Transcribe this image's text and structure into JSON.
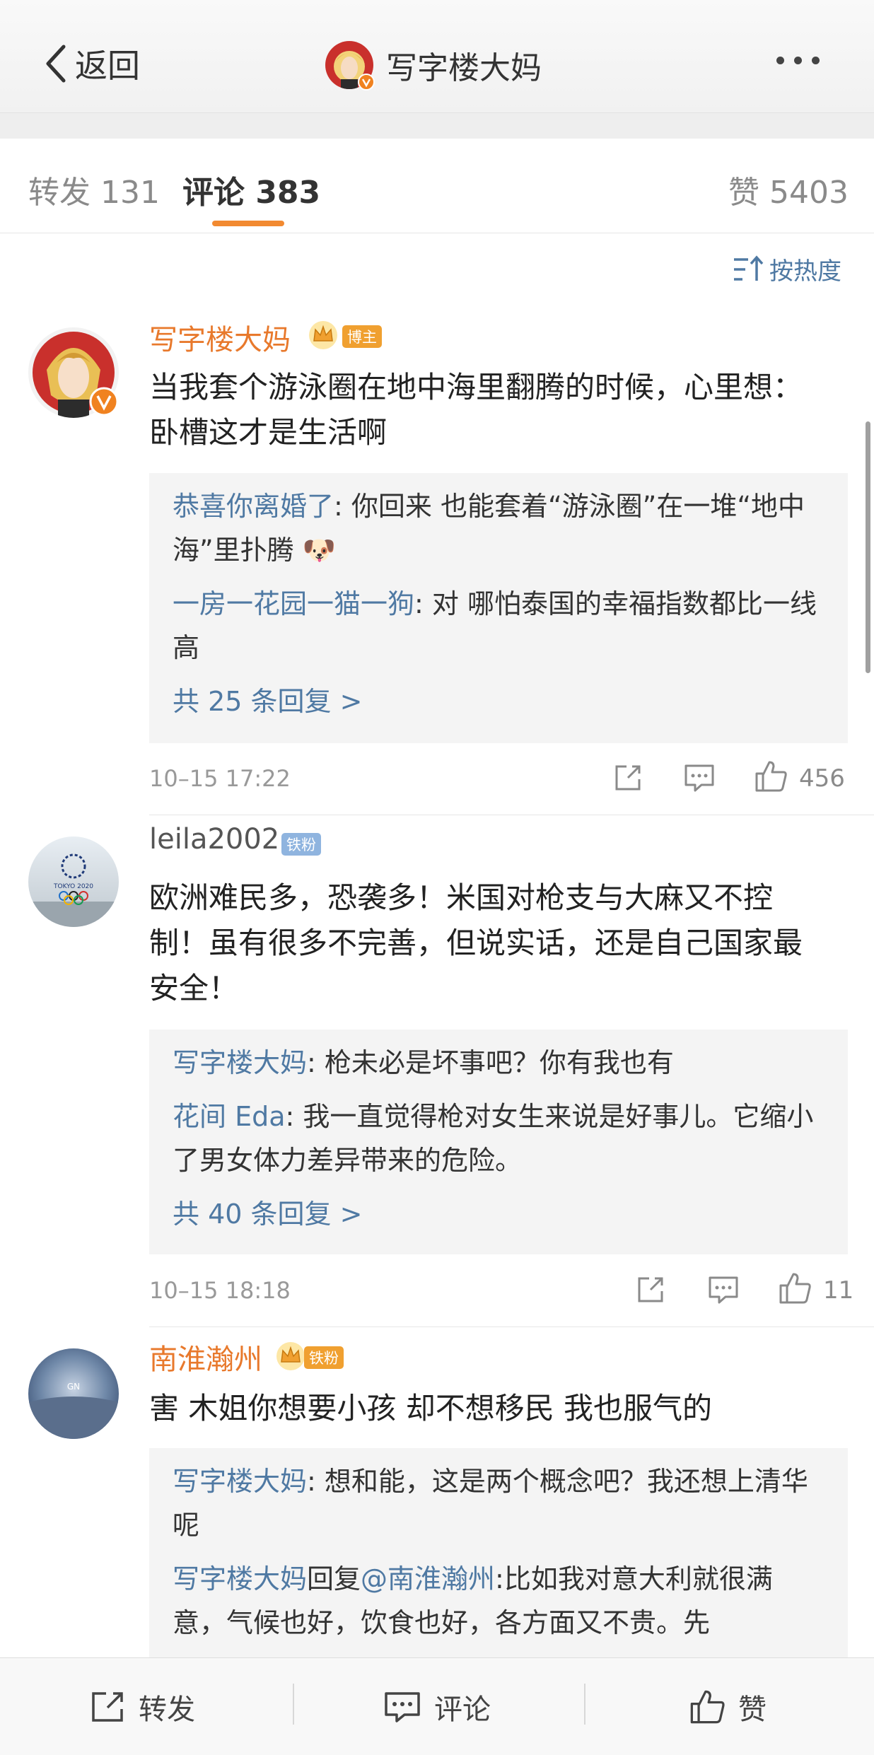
{
  "header": {
    "back_label": "返回",
    "title": "写字楼大妈"
  },
  "tabs": {
    "repost": "转发 131",
    "comments": "评论 383",
    "likes": "赞 5403"
  },
  "sort_label": "按热度",
  "colors": {
    "accent_orange": "#e8792c",
    "link_blue": "#4f79a3",
    "tab_underline": "#f28a31",
    "badge_blogger": "#f0a030",
    "badge_fan": "#8fb4df"
  },
  "comments": [
    {
      "user": "写字楼大妈",
      "badge": "博主",
      "text": "当我套个游泳圈在地中海里翻腾的时候，心里想：卧槽这才是生活啊",
      "replies": [
        {
          "user": "恭喜你离婚了",
          "sep": ": ",
          "text": "你回来 也能套着“游泳圈”在一堆“地中海”里扑腾",
          "emoji": "🐶"
        },
        {
          "user": "一房一花园一猫一狗",
          "sep": ": ",
          "text": "对 哪怕泰国的幸福指数都比一线高"
        }
      ],
      "more_replies": "共 25 条回复 >",
      "time": "10–15 17:22",
      "likes": "456"
    },
    {
      "user": "leila2002",
      "badge": "铁粉",
      "avatar_text": "TOKYO 2020",
      "text": "欧洲难民多，恐袭多！米国对枪支与大麻又不控制！虽有很多不完善，但说实话，还是自己国家最安全！",
      "replies": [
        {
          "user": "写字楼大妈",
          "sep": ": ",
          "text": "枪未必是坏事吧？你有我也有"
        },
        {
          "user": "花间 Eda",
          "sep": ": ",
          "text": "我一直觉得枪对女生来说是好事儿。它缩小了男女体力差异带来的危险。"
        }
      ],
      "more_replies": "共 40 条回复 >",
      "time": "10–15 18:18",
      "likes": "11"
    },
    {
      "user": "南淮瀚州",
      "badge": "铁粉",
      "text": "害 木姐你想要小孩 却不想移民 我也服气的",
      "replies": [
        {
          "user": "写字楼大妈",
          "sep": ": ",
          "text": "想和能，这是两个概念吧？我还想上清华呢"
        },
        {
          "user": "写字楼大妈",
          "reply_word": "回复",
          "mention": "@南淮瀚州",
          "sep": ":",
          "text": "比如我对意大利就很满意，气候也好，饮食也好，各方面又不贵。先"
        }
      ]
    }
  ],
  "bottom_bar": {
    "repost": "转发",
    "comment": "评论",
    "like": "赞"
  }
}
